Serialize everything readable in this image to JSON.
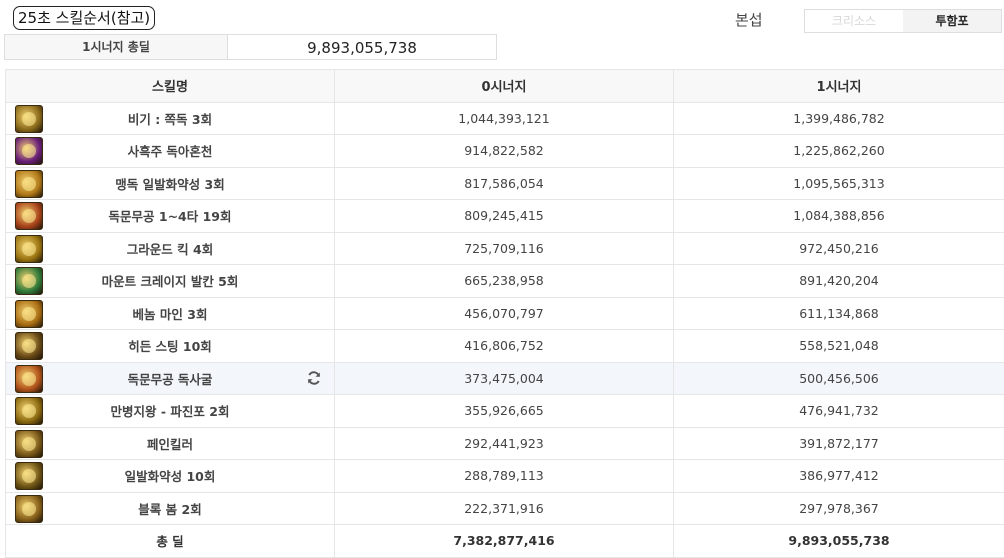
{
  "header": {
    "title": "25초 스킬순서(참고)",
    "server_label": "본섭",
    "toggle": [
      {
        "label": "크리소스",
        "active": false
      },
      {
        "label": "투함포",
        "active": true
      }
    ]
  },
  "summary": {
    "label": "1시너지 총딜",
    "value": "9,893,055,738"
  },
  "table": {
    "columns": [
      "스킬명",
      "0시너지",
      "1시너지"
    ],
    "rows": [
      {
        "name": "비기 : 쪽독 3회",
        "s0": "1,044,393,121",
        "s1": "1,399,486,782",
        "icon": "skill-icon-gold-cross",
        "icon_color": "#8a6a1a"
      },
      {
        "name": "사흑주 독아혼천",
        "s0": "914,822,582",
        "s1": "1,225,862,260",
        "icon": "skill-icon-purple",
        "icon_color": "#6a1f7a"
      },
      {
        "name": "맹독 일발화약성 3회",
        "s0": "817,586,054",
        "s1": "1,095,565,313",
        "icon": "skill-icon-swirl",
        "icon_color": "#b07818"
      },
      {
        "name": "독문무공 1~4타 19회",
        "s0": "809,245,415",
        "s1": "1,084,388,856",
        "icon": "skill-icon-fire",
        "icon_color": "#a8421a"
      },
      {
        "name": "그라운드 킥 4회",
        "s0": "725,709,116",
        "s1": "972,450,216",
        "icon": "skill-icon-kick",
        "icon_color": "#9a7410"
      },
      {
        "name": "마운트 크레이지 발칸 5회",
        "s0": "665,238,958",
        "s1": "891,420,204",
        "icon": "skill-icon-green",
        "icon_color": "#2f7a3a"
      },
      {
        "name": "베놈 마인 3회",
        "s0": "456,070,797",
        "s1": "611,134,868",
        "icon": "skill-icon-mine",
        "icon_color": "#a86c12"
      },
      {
        "name": "히든 스팅 10회",
        "s0": "416,806,752",
        "s1": "558,521,048",
        "icon": "skill-icon-sting",
        "icon_color": "#6a4a16"
      },
      {
        "name": "독문무공 독사굴",
        "s0": "373,475,004",
        "s1": "500,456,506",
        "icon": "skill-icon-snake",
        "icon_color": "#b0521a",
        "refresh": "refresh-icon"
      },
      {
        "name": "만병지왕 - 파진포 2회",
        "s0": "355,926,665",
        "s1": "476,941,732",
        "icon": "skill-icon-wave",
        "icon_color": "#8c6a10"
      },
      {
        "name": "페인킬러",
        "s0": "292,441,923",
        "s1": "391,872,177",
        "icon": "skill-icon-painkiller",
        "icon_color": "#7a5818"
      },
      {
        "name": "일발화약성 10회",
        "s0": "288,789,113",
        "s1": "386,977,412",
        "icon": "skill-icon-bomb",
        "icon_color": "#6e5414"
      },
      {
        "name": "블록 봄 2회",
        "s0": "222,371,916",
        "s1": "297,978,367",
        "icon": "skill-icon-block",
        "icon_color": "#86601a"
      }
    ],
    "total": {
      "label": "총 딜",
      "s0": "7,382,877,416",
      "s1": "9,893,055,738"
    }
  }
}
